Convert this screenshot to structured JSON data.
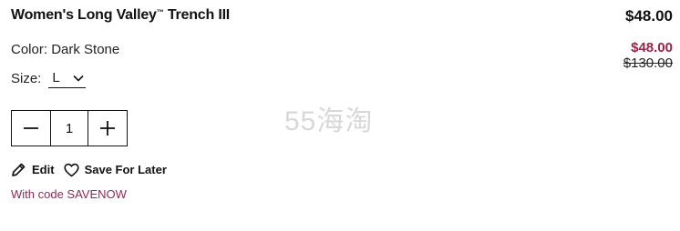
{
  "product": {
    "name": "Women's Long Valley",
    "trademark": "™",
    "name_suffix": "Trench III",
    "total_price": "$48.00",
    "color_label": "Color:",
    "color_value": "Dark Stone",
    "size_label": "Size:",
    "size_value": "L",
    "sale_price": "$48.00",
    "original_price": "$130.00"
  },
  "quantity": {
    "value": "1",
    "decrement_icon": "minus-icon",
    "increment_icon": "plus-icon"
  },
  "actions": {
    "edit_label": "Edit",
    "edit_icon": "pencil-icon",
    "save_label": "Save For Later",
    "save_icon": "heart-icon"
  },
  "promo": {
    "text": "With code SAVENOW"
  },
  "watermark": {
    "text": "55海淘"
  },
  "colors": {
    "sale": "#9b2244",
    "promo": "#8a2d54",
    "watermark": "#d8d8d8"
  }
}
